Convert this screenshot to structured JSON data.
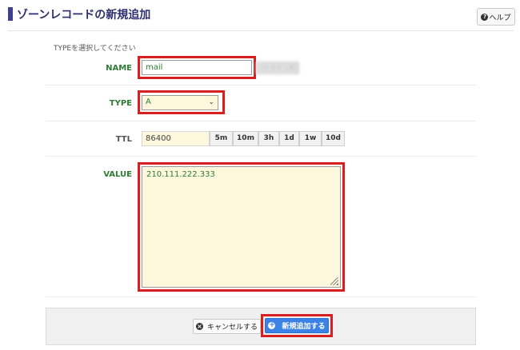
{
  "page": {
    "title": "ゾーンレコードの新規追加",
    "help_label": "ヘルプ",
    "help_icon": "question-circle-icon",
    "instruction": "TYPEを選択してください"
  },
  "form": {
    "name": {
      "label": "NAME",
      "value": "mail",
      "domain_suffix": "（ドメイン名）"
    },
    "type": {
      "label": "TYPE",
      "selected": "A"
    },
    "ttl": {
      "label": "TTL",
      "value": "86400",
      "presets": [
        "5m",
        "10m",
        "3h",
        "1d",
        "1w",
        "10d"
      ]
    },
    "value": {
      "label": "VALUE",
      "content": "210.111.222.333"
    }
  },
  "actions": {
    "cancel_label": "キャンセルする",
    "cancel_icon": "times-circle-icon",
    "add_label": "新規追加する",
    "add_icon": "plus-circle-icon"
  },
  "colors": {
    "accent": "#3f3f8f",
    "label_green": "#2e7d32",
    "highlight_red": "#d81f1f",
    "primary_button": "#3b82e6",
    "input_bg": "#fdf7dd"
  }
}
